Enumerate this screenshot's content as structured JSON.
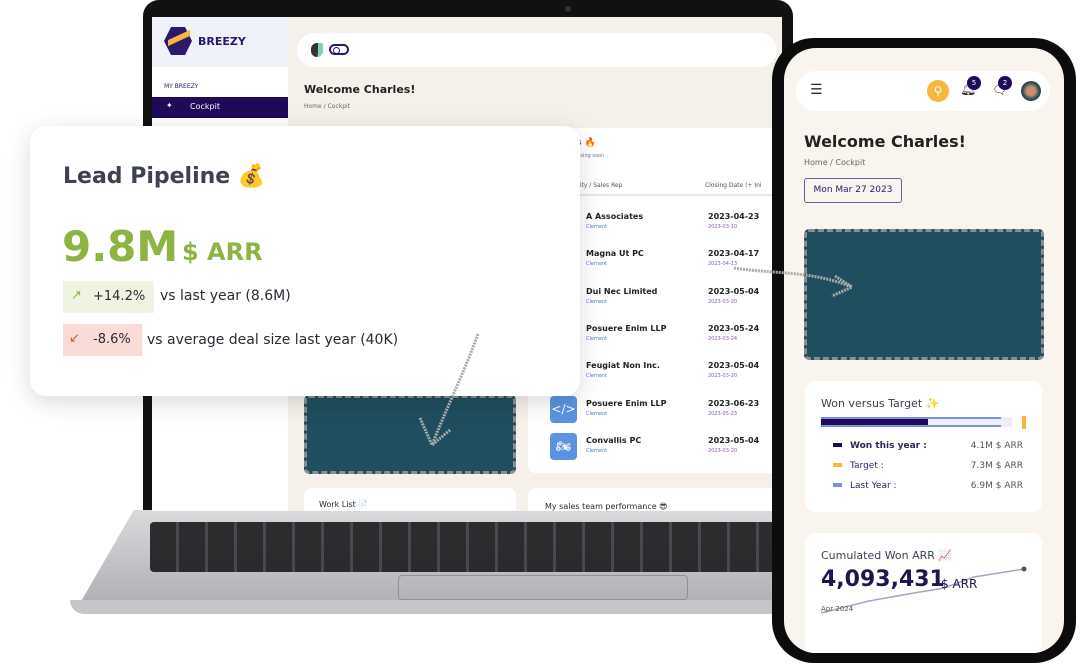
{
  "colors": {
    "brand": "#1f0a5a",
    "accent_yellow": "#f6b73c",
    "green": "#8db343",
    "red": "#e0533c",
    "teal": "#1f4e5f",
    "last_year": "#7b8fe0"
  },
  "laptop": {
    "sidebar": {
      "logo_text": "BREEZY",
      "section": "MY BREEZY",
      "items": [
        {
          "label": "Cockpit",
          "icon": "sparkle-icon",
          "active": true
        }
      ]
    },
    "header": {
      "title": "Welcome Charles!",
      "breadcrumb": [
        "Home",
        "/",
        "Cockpit"
      ]
    },
    "deals_card": {
      "title_fragment": "s 🔥",
      "subtitle_fragment": "losing soon",
      "columns": [
        "nity / Sales Rep",
        "Closing Date (+ Ini"
      ],
      "rows": [
        {
          "name": "A Associates",
          "rep": "Clement",
          "closing": "2023-04-23",
          "initial": "2023-03-10",
          "icon": ""
        },
        {
          "name": "Magna Ut PC",
          "rep": "Clement",
          "closing": "2023-04-17",
          "initial": "2023-04-13",
          "icon": ""
        },
        {
          "name": "Dui Nec Limited",
          "rep": "Clement",
          "closing": "2023-05-04",
          "initial": "2023-03-20",
          "icon": ""
        },
        {
          "name": "Posuere Enim LLP",
          "rep": "Clement",
          "closing": "2023-05-24",
          "initial": "2023-03-24",
          "icon": ""
        },
        {
          "name": "Feugiat Non Inc.",
          "rep": "Clement",
          "closing": "2023-05-04",
          "initial": "2023-03-20",
          "icon": ""
        },
        {
          "name": "Posuere Enim LLP",
          "rep": "Clement",
          "closing": "2023-06-23",
          "initial": "2023-05-23",
          "icon": "code-icon"
        },
        {
          "name": "Convallis PC",
          "rep": "Clement",
          "closing": "2023-05-04",
          "initial": "2023-03-20",
          "icon": "motorbike-icon"
        }
      ]
    },
    "work_list": "Work List 📄",
    "sales_perf": "My sales team performance 😎"
  },
  "lead_pipeline": {
    "title": "Lead Pipeline 💰",
    "value": "9.8M",
    "unit": "$ ARR",
    "deltas": [
      {
        "arrow": "↗",
        "value": "+14.2%",
        "label": "vs last year (8.6M)",
        "trend": "up"
      },
      {
        "arrow": "↙",
        "value": "-8.6%",
        "label": "vs average deal size last year (40K)",
        "trend": "down"
      }
    ]
  },
  "phone": {
    "notifications": "5",
    "messages": "2",
    "title": "Welcome Charles!",
    "breadcrumb": [
      "Home",
      "/",
      "Cockpit"
    ],
    "date": "Mon Mar 27 2023",
    "won_vs_target": {
      "title": "Won versus Target ✨",
      "won_fraction": 0.56,
      "last_year_fraction": 0.945,
      "legend": [
        {
          "label": "Won this year :",
          "value": "4.1M $ ARR",
          "color": "#1f0a5a"
        },
        {
          "label": "Target :",
          "value": "7.3M $ ARR",
          "color": "#f6b73c"
        },
        {
          "label": "Last Year :",
          "value": "6.9M $ ARR",
          "color": "#7b8fe0"
        }
      ]
    },
    "cumulated": {
      "title": "Cumulated Won ARR 📈",
      "value": "4,093,431",
      "unit": "$ ARR",
      "x_label": "Apr 2024"
    }
  }
}
